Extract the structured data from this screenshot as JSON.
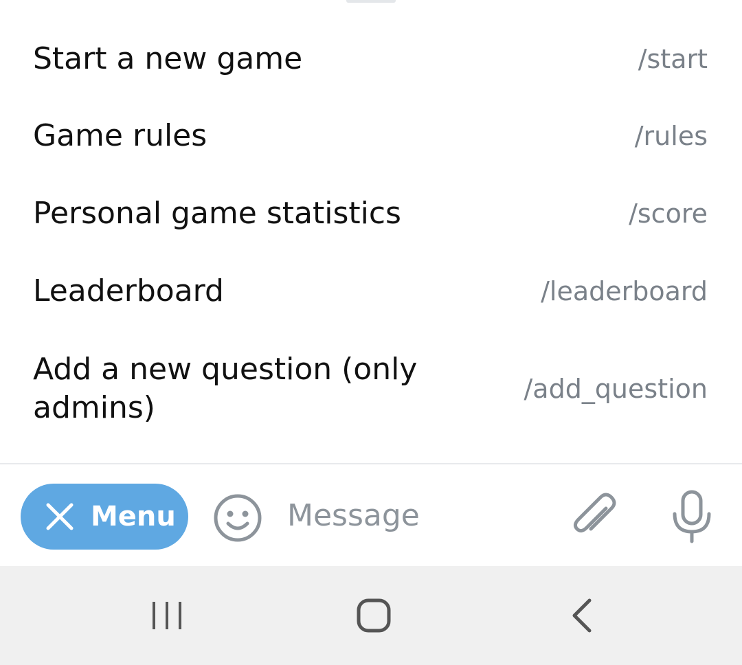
{
  "commands": [
    {
      "description": "Start a new game",
      "command": "/start"
    },
    {
      "description": "Game rules",
      "command": "/rules"
    },
    {
      "description": "Personal game statistics",
      "command": "/score"
    },
    {
      "description": "Leaderboard",
      "command": "/leaderboard"
    },
    {
      "description": "Add a new question (only admins)",
      "command": "/add_question"
    }
  ],
  "input_bar": {
    "menu_label": "Menu",
    "menu_icon": "close-icon",
    "emoji_icon": "smiley-icon",
    "message_placeholder": "Message",
    "message_value": "",
    "attach_icon": "paperclip-icon",
    "mic_icon": "microphone-icon"
  },
  "nav_bar": {
    "recents_icon": "recent-apps-icon",
    "home_icon": "home-icon",
    "back_icon": "back-icon"
  },
  "colors": {
    "menu_button": "#5fa8e2",
    "command_text": "#7a8189",
    "description_text": "#111111",
    "nav_background": "#f0f0f0",
    "icon_gray": "#8d949b"
  }
}
